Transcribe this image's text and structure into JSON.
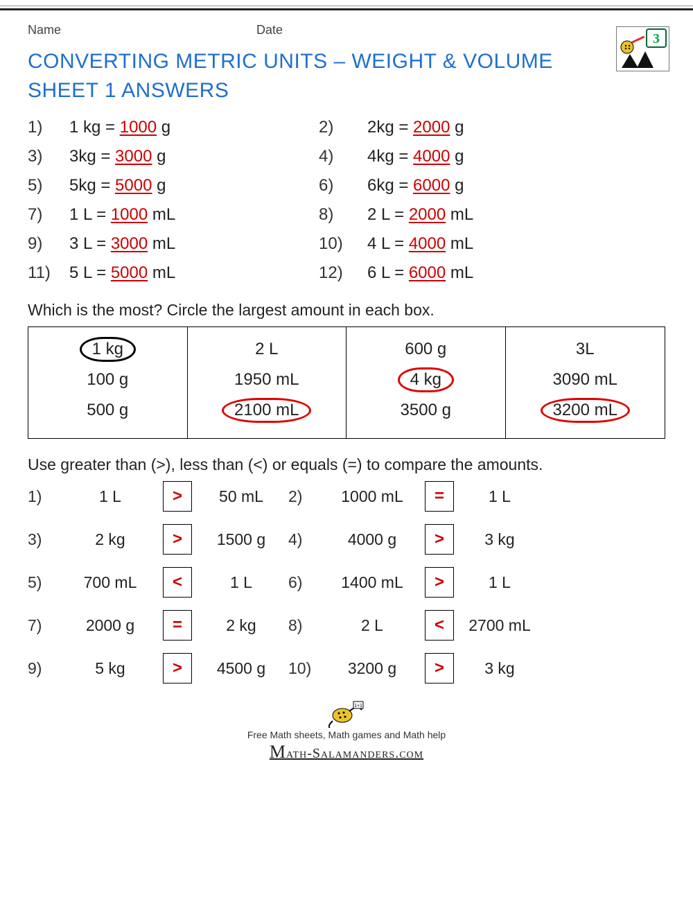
{
  "header": {
    "name_label": "Name",
    "date_label": "Date"
  },
  "title_line1": "CONVERTING METRIC UNITS – WEIGHT & VOLUME",
  "title_line2": "SHEET 1 ANSWERS",
  "grade_level": "3",
  "conversions": [
    {
      "n": "1)",
      "pre": "1 kg = ",
      "ans": "1000",
      "post": " g"
    },
    {
      "n": "2)",
      "pre": "2kg = ",
      "ans": "2000",
      "post": " g"
    },
    {
      "n": "3)",
      "pre": "3kg = ",
      "ans": "3000",
      "post": " g"
    },
    {
      "n": "4)",
      "pre": "4kg = ",
      "ans": "4000",
      "post": " g"
    },
    {
      "n": "5)",
      "pre": "5kg = ",
      "ans": "5000",
      "post": " g"
    },
    {
      "n": "6)",
      "pre": "6kg = ",
      "ans": "6000",
      "post": " g"
    },
    {
      "n": "7)",
      "pre": "1 L = ",
      "ans": "1000",
      "post": " mL"
    },
    {
      "n": "8)",
      "pre": "2 L = ",
      "ans": "2000",
      "post": " mL"
    },
    {
      "n": "9)",
      "pre": "3 L = ",
      "ans": "3000",
      "post": " mL"
    },
    {
      "n": "10)",
      "pre": "4 L = ",
      "ans": "4000",
      "post": " mL"
    },
    {
      "n": "11)",
      "pre": "5 L = ",
      "ans": "5000",
      "post": " mL"
    },
    {
      "n": "12)",
      "pre": "6 L = ",
      "ans": "6000",
      "post": " mL"
    }
  ],
  "circle_instr": "Which is the most? Circle the largest amount in each box.",
  "boxes": [
    {
      "items": [
        "1 kg",
        "100 g",
        "500 g"
      ],
      "ans_idx": 0,
      "color": "black"
    },
    {
      "items": [
        "2 L",
        "1950 mL",
        "2100 mL"
      ],
      "ans_idx": 2,
      "color": "red"
    },
    {
      "items": [
        "600 g",
        "4 kg",
        "3500 g"
      ],
      "ans_idx": 1,
      "color": "red"
    },
    {
      "items": [
        "3L",
        "3090 mL",
        "3200 mL"
      ],
      "ans_idx": 2,
      "color": "red"
    }
  ],
  "compare_instr": "Use greater than (>), less than (<) or equals (=) to compare the amounts.",
  "compares": [
    {
      "n": "1)",
      "a": "1 L",
      "op": ">",
      "b": "50 mL"
    },
    {
      "n": "2)",
      "a": "1000 mL",
      "op": "=",
      "b": "1 L"
    },
    {
      "n": "3)",
      "a": "2 kg",
      "op": ">",
      "b": "1500 g"
    },
    {
      "n": "4)",
      "a": "4000 g",
      "op": ">",
      "b": "3 kg"
    },
    {
      "n": "5)",
      "a": "700 mL",
      "op": "<",
      "b": "1 L"
    },
    {
      "n": "6)",
      "a": "1400 mL",
      "op": ">",
      "b": "1 L"
    },
    {
      "n": "7)",
      "a": "2000 g",
      "op": "=",
      "b": "2 kg"
    },
    {
      "n": "8)",
      "a": "2 L",
      "op": "<",
      "b": "2700 mL"
    },
    {
      "n": "9)",
      "a": "5 kg",
      "op": ">",
      "b": "4500 g"
    },
    {
      "n": "10)",
      "a": "3200 g",
      "op": ">",
      "b": "3 kg"
    }
  ],
  "footer": {
    "tagline": "Free Math sheets, Math games and Math help",
    "brand": "ath-Salamanders.com"
  }
}
